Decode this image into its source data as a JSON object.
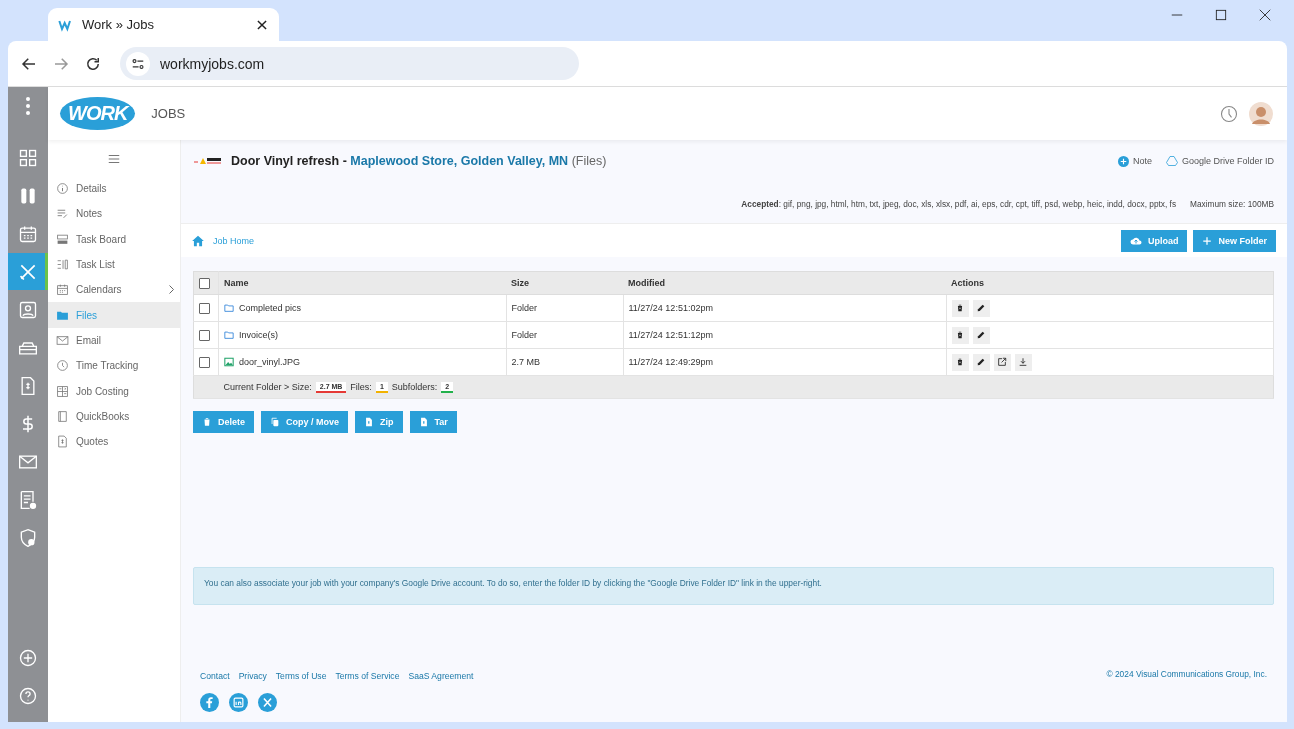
{
  "browser": {
    "tab_title": "Work » Jobs",
    "url": "workmyjobs.com"
  },
  "app": {
    "logo": "WORK",
    "section": "JOBS"
  },
  "rail": {
    "items": [
      {
        "selected": false
      },
      {
        "selected": false
      },
      {
        "selected": false
      },
      {
        "selected": true
      },
      {
        "selected": false
      },
      {
        "selected": false
      },
      {
        "selected": false
      },
      {
        "selected": false
      },
      {
        "selected": false
      },
      {
        "selected": false
      },
      {
        "selected": false
      }
    ]
  },
  "sidebar": {
    "items": [
      {
        "label": "Details",
        "selected": false,
        "submenu": false
      },
      {
        "label": "Notes",
        "selected": false,
        "submenu": false
      },
      {
        "label": "Task Board",
        "selected": false,
        "submenu": false
      },
      {
        "label": "Task List",
        "selected": false,
        "submenu": false
      },
      {
        "label": "Calendars",
        "selected": false,
        "submenu": true
      },
      {
        "label": "Files",
        "selected": true,
        "submenu": false
      },
      {
        "label": "Email",
        "selected": false,
        "submenu": false
      },
      {
        "label": "Time Tracking",
        "selected": false,
        "submenu": false
      },
      {
        "label": "Job Costing",
        "selected": false,
        "submenu": false
      },
      {
        "label": "QuickBooks",
        "selected": false,
        "submenu": false
      },
      {
        "label": "Quotes",
        "selected": false,
        "submenu": false
      }
    ]
  },
  "page": {
    "job": "Door Vinyl refresh",
    "separator": "-",
    "location": "Maplewood Store, Golden Valley, MN",
    "suffix": "(Files)",
    "top_links": [
      "Note",
      "Google Drive Folder ID"
    ],
    "accepted": "**Accepted**: gif, png, jpg, html, htm, txt, jpeg, doc, xls, xlsx, pdf, ai, eps, cdr, cpt, tiff, psd, webp, heic, indd, docx, pptx, fs",
    "max_size": "Maximum size: 100MB",
    "breadcrumb": "Job Home",
    "toolbar_buttons": [
      "Upload",
      "New Folder"
    ]
  },
  "table": {
    "columns": [
      "Name",
      "Size",
      "Modified",
      "Actions"
    ],
    "rows": [
      {
        "kind": "folder",
        "name": "Completed pics",
        "size": "Folder",
        "modified": "11/27/24 12:51:02pm",
        "checked": false
      },
      {
        "kind": "folder",
        "name": "Invoice(s)",
        "size": "Folder",
        "modified": "11/27/24 12:51:12pm",
        "checked": false
      },
      {
        "kind": "image",
        "name": "door_vinyl.JPG",
        "size": "2.7 MB",
        "modified": "11/27/24 12:49:29pm",
        "checked": false
      }
    ],
    "select_all_checked": false,
    "summary": {
      "label": "Current Folder > Size:",
      "stats": [
        {
          "value": "2.7 MB",
          "color": "#e53935"
        },
        {
          "label": "Files:",
          "value": "1",
          "color": "#f2b200"
        },
        {
          "label": "Subfolders:",
          "value": "2",
          "color": "#22b14c"
        }
      ]
    }
  },
  "bulk_buttons": [
    {
      "kind": "delete",
      "label": "Delete"
    },
    {
      "kind": "copy",
      "label": "Copy / Move"
    },
    {
      "kind": "file",
      "label": "Zip"
    },
    {
      "kind": "file",
      "label": "Tar"
    }
  ],
  "alert": "You can also associate your job with your company's Google Drive account. To do so, enter the folder ID by clicking the \"Google Drive Folder ID\" link in the upper-right.",
  "footer": {
    "links": [
      "Contact",
      "Privacy",
      "Terms of Use",
      "Terms of Service",
      "SaaS Agreement"
    ],
    "copyright": "© 2024 Visual Communications Group, Inc."
  }
}
